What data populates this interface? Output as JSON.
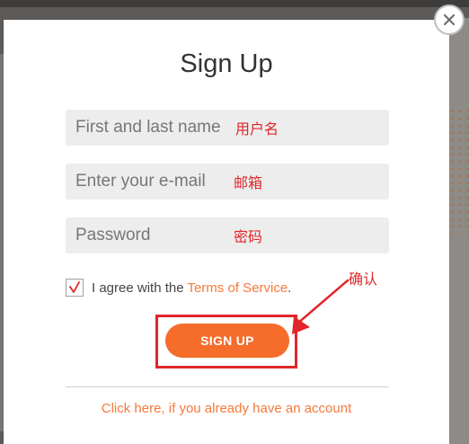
{
  "modal": {
    "title": "Sign Up",
    "fields": {
      "name": {
        "placeholder": "First and last name",
        "annotation": "用户名"
      },
      "email": {
        "placeholder": "Enter your e-mail",
        "annotation": "邮箱"
      },
      "password": {
        "placeholder": "Password",
        "annotation": "密码"
      }
    },
    "agree": {
      "checked": true,
      "check_glyph": "√",
      "text": "I agree with the ",
      "terms_link": "Terms of Service",
      "suffix": "."
    },
    "signup_button": "SIGN UP",
    "confirm_annotation": "确认",
    "login_link": "Click here, if you already have an account"
  },
  "colors": {
    "accent": "#f56c2b",
    "link": "#f47a3b",
    "annotation": "#e0262a",
    "field_bg": "#ededed",
    "overlay": "#5d5a58"
  },
  "icons": {
    "close": "close-icon",
    "checkbox": "checkmark-icon",
    "annotation_arrow": "arrow-icon"
  }
}
